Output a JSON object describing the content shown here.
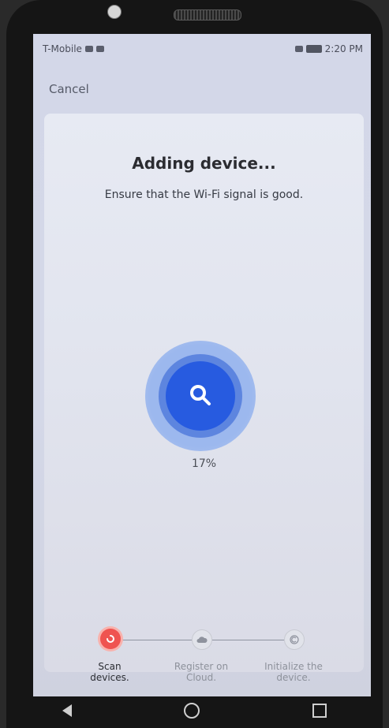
{
  "status_bar": {
    "carrier": "T-Mobile",
    "time": "2:20 PM"
  },
  "cancel_label": "Cancel",
  "title": "Adding device...",
  "subtitle": "Ensure that the Wi-Fi signal is good.",
  "progress_percent": "17%",
  "steps": [
    {
      "line1": "Scan",
      "line2": "devices.",
      "active": true
    },
    {
      "line1": "Register on",
      "line2": "Cloud.",
      "active": false
    },
    {
      "line1": "Initialize the",
      "line2": "device.",
      "active": false
    }
  ],
  "colors": {
    "accent_blue": "#275be0",
    "active_step": "#ef5350"
  },
  "icons": {
    "progress_center": "search-icon",
    "step_2": "cloud-icon",
    "step_3": "circle-c-icon"
  }
}
